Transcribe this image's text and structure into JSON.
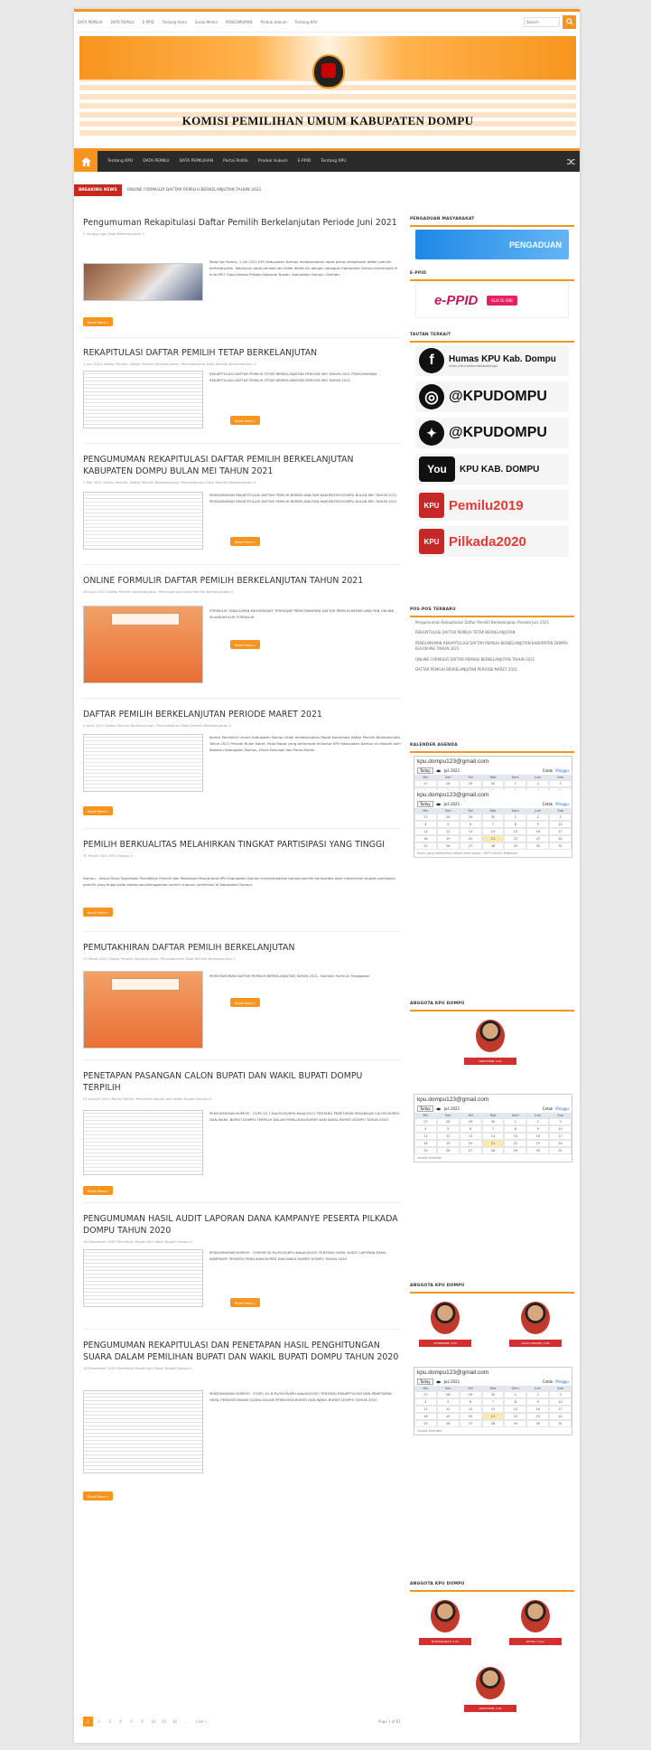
{
  "topbar": {
    "links": [
      "DATA PEMILIH",
      "DATA PEMILU",
      "E-PPID",
      "Tentang Kami",
      "Sosial Media",
      "PENGUMUMAN",
      "Produk Hukum",
      "Tentang KPU"
    ],
    "search_placeholder": "Search"
  },
  "banner": {
    "title": "KOMISI PEMILIHAN UMUM KABUPATEN DOMPU"
  },
  "nav": {
    "items": [
      "Tentang KPU",
      "DATA PEMILU",
      "DATA PEMILIHAN",
      "Partai Politik",
      "Produk Hukum",
      "E-PPID",
      "Tentang KPU"
    ]
  },
  "ticker": {
    "label": "BREAKING NEWS",
    "text": "ONLINE FORMULIR DAFTAR PEMILIH BERKELANJUTAN TAHUN 2021"
  },
  "posts": [
    {
      "title": "Pengumuman Rekapitulasi Daftar Pemilih Berkelanjutan Periode Juni 2021",
      "meta": "3 minggu ago   Data Berkelanjutan   0",
      "excerpt": "Pada hari Kamis, 1 Juli 2021 KPU Kabupaten Dompu melaksanakan rapat pleno rekapitulasi daftar pemilih berkelanjutan. Walaupun pada periode lalu tidak didahului dengan sebagian Kabupaten Dompu bertempat di aula KPU. Sapa Dewan Pilkada Nasional Bupati. Kabupaten Dompu, Dzimbin",
      "more": "Read More »"
    },
    {
      "title": "REKAPITULASI DAFTAR PEMILIH TETAP BERKELANJUTAN",
      "meta": "1 Juni 2021   Daftar Pemilih, Daftar Pemilih Berkelanjutan, Pemutakhiran Data Pemilih Berkelanjutan   0",
      "excerpt": "REKAPITULASI DAFTAR PEMILIH TETAP BERKELANJUTAN PERIODE MEI TAHUN 2021 PENGUMUMAN REKAPITULASI DAFTAR PEMILIH TETAP BERKELANJUTAN PERIODE MEI TAHUN 2021",
      "more": "Read More »"
    },
    {
      "title": "PENGUMUMAN REKAPITULASI DAFTAR PEMILIH BERKELANJUTAN KABUPATEN DOMPU BULAN MEI TAHUN 2021",
      "meta": "1 Mei 2021   Daftar Pemilih, Daftar Pemilih Berkelanjutan, Pemutakhiran Data Pemilih Berkelanjutan   0",
      "excerpt": "PENGUMUMAN REKAPITULASI DAFTAR PEMILIH BERKELANJUTAN KABUPATEN DOMPU BULAN MEI TAHUN 2021 PENGUMUMAN REKAPITULASI DAFTAR PEMILIH BERKELANJUTAN KABUPATEN DOMPU BULAN MEI TAHUN 2021",
      "more": "Read More »"
    },
    {
      "title": "ONLINE FORMULIR DAFTAR PEMILIH BERKELANJUTAN TAHUN 2021",
      "meta": "28 April 2021   Daftar Pemilih Berkelanjutan, Pemutakhiran Data Pemilih Berkelanjutan   0",
      "excerpt": "FORMULIR TANGGAPAN MASYARAKAT TERHADAP PEMUTAKHIRAN DAFTAR PEMILIH BERKELANJUTAN ONLINE. SILAHKAN KLIK FORMULIR",
      "more": "Read More »"
    },
    {
      "title": "DAFTAR PEMILIH BERKELANJUTAN PERIODE MARET 2021",
      "meta": "6 April 2021   Daftar Pemilih Berkelanjutan, Pemutakhiran Data Pemilih Berkelanjutan   0",
      "excerpt": "Komisi Pemilihan Umum Kabupaten Dompu telah melaksanakan Rapat Koordinasi Daftar Pemilih Berkelanjutan Tahun 2021 Periode Bulan Maret. Pada Rapat yang bertempat di Kantor KPU Kabupaten Dompu ini dihadiri oleh Bawaslu Kabupaten Dompu, Dinas Dukcapil dan Partai Politik.",
      "more": "Read More »"
    },
    {
      "title": "PEMILIH BERKUALITAS MELAHIRKAN TINGKAT PARTISIPASI YANG TINGGI",
      "meta": "31 Maret 2021   KPU Dompu   0",
      "excerpt": "",
      "body": "Dompu – Ketua Divisi Sosialisasi Pendidikan Pemilih dan Partisipasi Masyarakat KPU Kabupaten Dompu menyampaikan bahwa pemilih berkualitas akan melahirkan tingkat partisipasi pemilih yang tinggi pada setiap penyelenggaraan pemilu maupun pemilihan di Kabupaten Dompu.",
      "more": "Read More »"
    },
    {
      "title": "PEMUTAKHIRAN DAFTAR PEMILIH BERKELANJUTAN",
      "meta": "13 Maret 2021   Daftar Pemilih Berkelanjutan, Pemutakhiran Data Pemilih Berkelanjutan   0",
      "excerpt": "PEMUTAKHIRAN DAFTAR PEMILIH BERKELANJUTAN TAHUN 2021. Silahkan Formulir Tanggapan",
      "more": "Read More »"
    },
    {
      "title": "PENETAPAN PASANGAN CALON BUPATI DAN WAKIL BUPATI DOMPU TERPILIH",
      "meta": "21 Januari 2021   Berita Terkini, Pemilihan Bupati dan Wakil Bupati Dompu   0",
      "excerpt": "PENGUMUMAN NOMOR : 15/PL.02.7-Kpt/5205/KPU-Kab/I/2021 TENTANG PENETAPAN PASANGAN CALON BUPATI DAN WAKIL BUPATI DOMPU TERPILIH DALAM PEMILIHAN BUPATI DAN WAKIL BUPATI DOMPU TAHUN 2020",
      "more": "Read More »"
    },
    {
      "title": "PENGUMUMAN HASIL AUDIT LAPORAN DANA KAMPANYE PESERTA PILKADA DOMPU TAHUN 2020",
      "meta": "18 Desember 2020   Pemilihan Bupati dan Wakil Bupati Dompu   0",
      "excerpt": "PENGUMUMAN NOMOR : 339/HM.02-Pu/5205/KPU-Kab/XII/2020 TENTANG HASIL AUDIT LAPORAN DANA KAMPANYE PESERTA PEMILIHAN BUPATI DAN WAKIL BUPATI DOMPU TAHUN 2020",
      "more": "Read More »"
    },
    {
      "title": "PENGUMUMAN REKAPITULASI DAN PENETAPAN HASIL PENGHITUNGAN SUARA DALAM PEMILIHAN BUPATI DAN WAKIL BUPATI DOMPU TAHUN 2020",
      "meta": "18 Desember 2020   Pemilihan Bupati dan Wakil Bupati Dompu   0",
      "excerpt": "PENGUMUMAN NOMOR : 370/PL.02.6-Pu/5205/KPU-Kab/XII/2020 TENTANG REKAPITULASI DAN PENETAPAN HASIL PENGHITUNGAN SUARA DALAM PEMILIHAN BUPATI DAN WAKIL BUPATI DOMPU TAHUN 2020",
      "more": "Read More »"
    }
  ],
  "pagination": {
    "pages": [
      "1",
      "2",
      "3",
      "4",
      "5",
      "6",
      "10",
      "20",
      "30",
      "...",
      "Last »"
    ],
    "label": "Page 1 of 61"
  },
  "sidebar": {
    "pengaduan_title": "PENGADUAN MASYARAKAT",
    "pengaduan_banner": "PENGADUAN",
    "eppid_title": "E-PPID",
    "eppid_banner": "e-PPID",
    "eppid_btn": "KLIK DI SINI",
    "social_title": "TAUTAN TERKAIT",
    "social": [
      {
        "icon": "facebook-icon",
        "glyph": "f",
        "text": "Humas KPU Kab. Dompu",
        "sub": "https://fb.me/humaskpudompu"
      },
      {
        "icon": "instagram-icon",
        "glyph": "◎",
        "text": "@KPUDOMPU",
        "sub": ""
      },
      {
        "icon": "twitter-icon",
        "glyph": "✦",
        "text": "@KPUDOMPU",
        "sub": ""
      },
      {
        "icon": "youtube-icon",
        "glyph": "You",
        "text": "KPU KAB. DOMPU",
        "sub": ""
      },
      {
        "icon": "kpu-logo-icon",
        "glyph": "KPU",
        "text": "Pemilu2019",
        "sub": ""
      },
      {
        "icon": "kpu-logo-icon",
        "glyph": "KPU",
        "text": "Pilkada2020",
        "sub": ""
      }
    ],
    "recent_title": "POS-POS TERBARU",
    "recent": [
      "Pengumuman Rekapitulasi Daftar Pemilih Berkelanjutan Periode Juni 2021",
      "REKAPITULASI DAFTAR PEMILIH TETAP BERKELANJUTAN",
      "PENGUMUMAN REKAPITULASI DAFTAR PEMILIH BERKELANJUTAN KABUPATEN DOMPU BULAN MEI TAHUN 2021",
      "ONLINE FORMULIR DAFTAR PEMILIH BERKELANJUTAN TAHUN 2021",
      "DAFTAR PEMILIH BERKELANJUTAN PERIODE MARET 2021"
    ],
    "calendar_title": "KALENDER AGENDA",
    "calendar": {
      "email": "kpu.dompu123@gmail.com",
      "today": "Today",
      "month": "Juli 2021",
      "print": "Cetak",
      "week": "Minggu",
      "days": [
        "Min",
        "Sen",
        "Sel",
        "Rab",
        "Kam",
        "Jum",
        "Sab"
      ],
      "nums": [
        "27",
        "28",
        "29",
        "30",
        "1",
        "2",
        "3",
        "4",
        "5",
        "6",
        "7",
        "8",
        "9",
        "10",
        "11",
        "12",
        "13",
        "14",
        "15",
        "16",
        "17",
        "18",
        "19",
        "20",
        "21",
        "22",
        "23",
        "24",
        "25",
        "26",
        "27",
        "28",
        "29",
        "30",
        "31"
      ],
      "timezone": "Acara yang ditampilkan dalam zona waktu: (GMT+08:00) Makassar",
      "footer": "Google Kalender"
    },
    "anggota_title": "ANGGOTA KPU DOMPU",
    "members": [
      "ARIFUDDIN, S.Pd",
      "SUHERMAN, S.Pd",
      "AGUS SUPARDI, S.Pd",
      "NURHASANAH, S.Pd",
      "IDHAR, S.Sos"
    ]
  }
}
